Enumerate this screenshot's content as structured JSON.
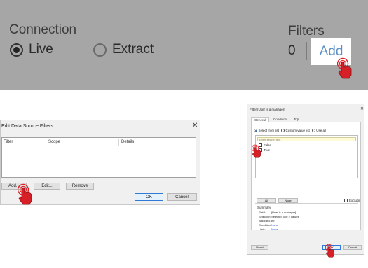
{
  "banner": {
    "connection_label": "Connection",
    "live_label": "Live",
    "extract_label": "Extract",
    "filters_label": "Filters",
    "filters_count": "0",
    "add_label": "Add",
    "selected": "Live"
  },
  "edit_dialog": {
    "title": "Edit Data Source Filters",
    "close_glyph": "✕",
    "columns": [
      "Filter",
      "Scope",
      "Details"
    ],
    "add_label": "Add...",
    "edit_label": "Edit...",
    "remove_label": "Remove",
    "ok_label": "OK",
    "cancel_label": "Cancel"
  },
  "filter_dialog": {
    "title": "Filter [User is a manager]",
    "close_glyph": "✕",
    "tabs": [
      "General",
      "Condition",
      "Top"
    ],
    "options": [
      "Select from list",
      "Custom value list",
      "Use all"
    ],
    "selected_option": "Select from list",
    "search_placeholder": "Enter search text",
    "values": [
      "False",
      "True"
    ],
    "all_label": "All",
    "none_label": "None",
    "exclude_label": "Exclude",
    "summary": {
      "title": "Summary",
      "rows": [
        {
          "key": "Field:",
          "value": "[User is a manager]"
        },
        {
          "key": "Selection:",
          "value": "Selected 0 of 2 values"
        },
        {
          "key": "Wildcard:",
          "value": "All"
        },
        {
          "key": "Condition:",
          "value": "None"
        },
        {
          "key": "Limit:",
          "value": "None"
        }
      ]
    },
    "reset_label": "Reset",
    "ok_label": "OK",
    "cancel_label": "Cancel"
  },
  "colors": {
    "banner_bg": "#a6a6a6",
    "add_link": "#5b8fc6",
    "hand_red": "#d61f26",
    "link_blue": "#1a55c8"
  },
  "icons": [
    "hand-pointer-icon",
    "close-icon",
    "radio-icon",
    "checkbox-icon"
  ]
}
